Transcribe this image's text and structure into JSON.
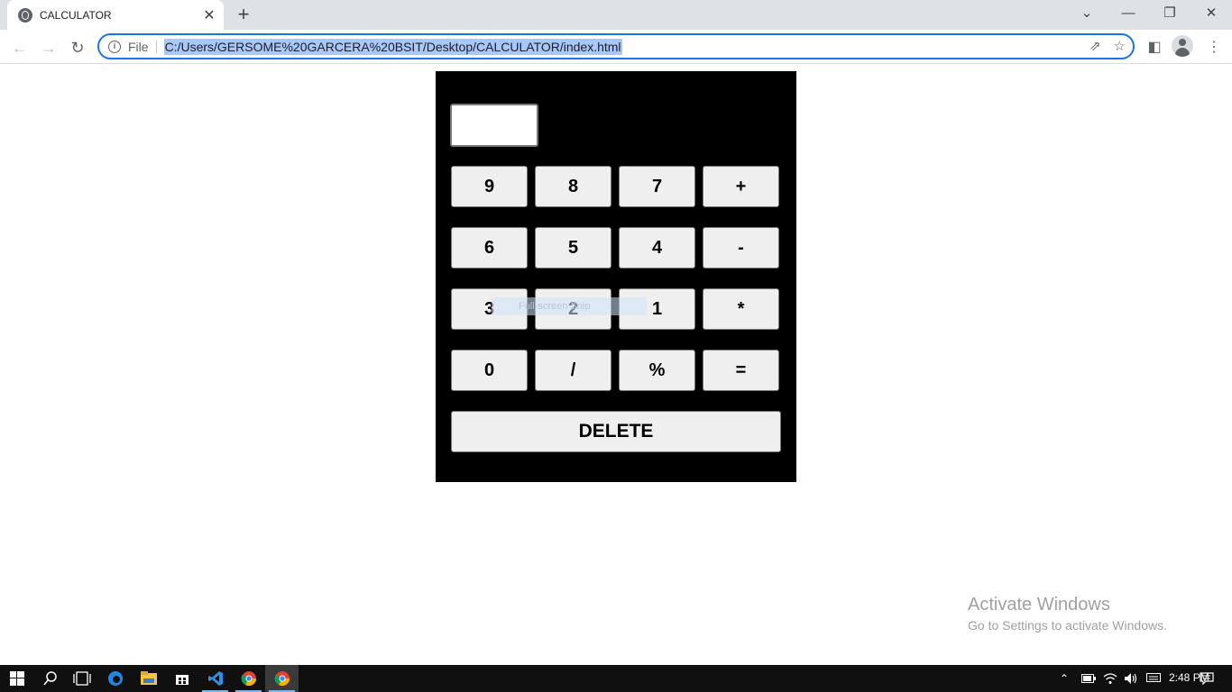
{
  "browser": {
    "tab_title": "CALCULATOR",
    "tab_close": "✕",
    "new_tab": "+",
    "address_scheme": "File",
    "address_url": "C:/Users/GERSOME%20GARCERA%20BSIT/Desktop/CALCULATOR/index.html",
    "window_controls": [
      "⌄",
      "—",
      "❐",
      "✕"
    ]
  },
  "calculator": {
    "display_value": "",
    "keys": [
      [
        "9",
        "8",
        "7",
        "+"
      ],
      [
        "6",
        "5",
        "4",
        "-"
      ],
      [
        "3",
        "2",
        "1",
        "*"
      ],
      [
        "0",
        "/",
        "%",
        "="
      ]
    ],
    "delete_label": "DELETE"
  },
  "overlay": {
    "snip_text": "Full-screen Snip"
  },
  "watermark": {
    "line1": "Activate Windows",
    "line2": "Go to Settings to activate Windows."
  },
  "taskbar": {
    "time": "2:48 PM"
  }
}
